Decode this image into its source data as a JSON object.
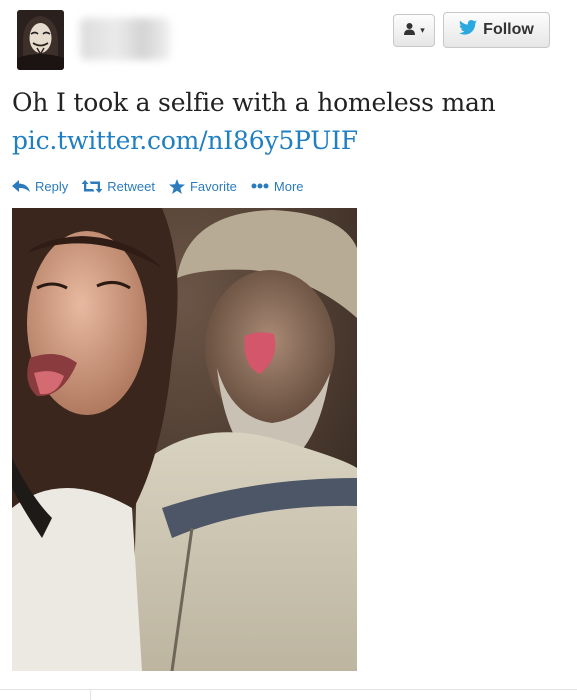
{
  "header": {
    "user_menu_icon": "person-icon",
    "follow_label": "Follow",
    "follow_icon": "twitter-bird-icon"
  },
  "tweet": {
    "text": "Oh I took a selfie with a homeless man",
    "link": "pic.twitter.com/nI86y5PUIF"
  },
  "actions": [
    {
      "label": "Reply",
      "icon": "reply-arrow-icon"
    },
    {
      "label": "Retweet",
      "icon": "retweet-icon"
    },
    {
      "label": "Favorite",
      "icon": "star-icon"
    },
    {
      "label": "More",
      "icon": "more-dots-icon"
    }
  ],
  "colors": {
    "link": "#1f7fc2",
    "action": "#2b7bbd",
    "twitter_blue": "#2aa9e0"
  }
}
